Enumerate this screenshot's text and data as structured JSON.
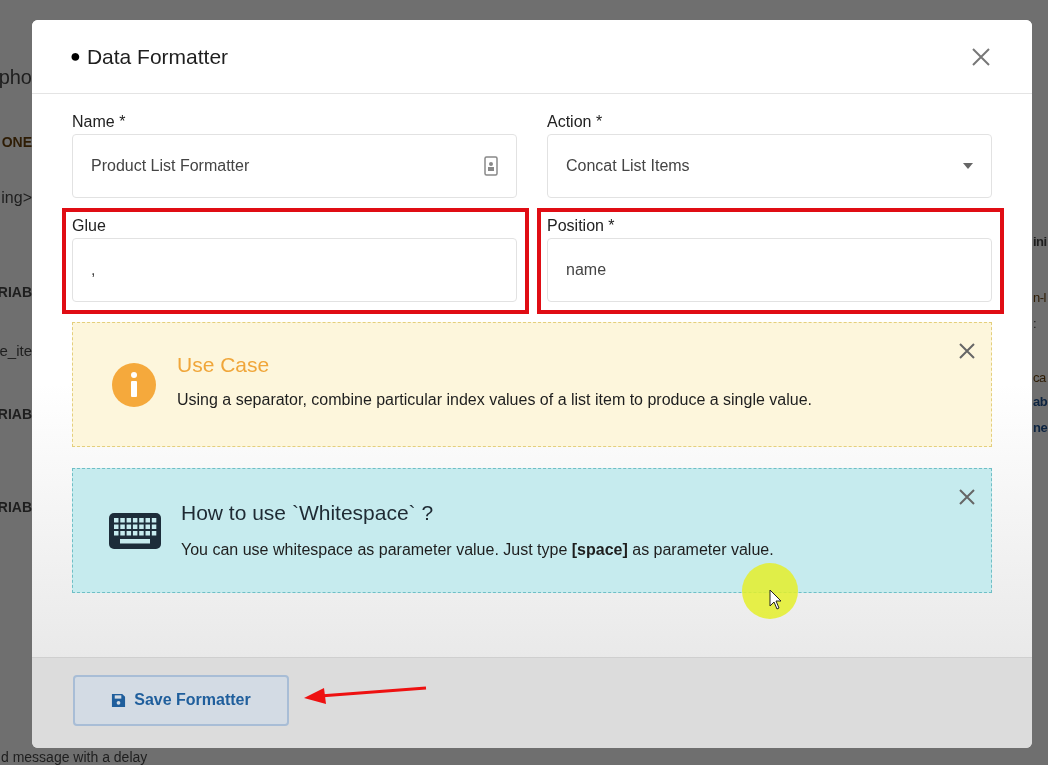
{
  "background": {
    "left_fragments": [
      "pho",
      "ONE",
      "ing>",
      "RIAB",
      "e_ite",
      "RIAB",
      "RIAB"
    ],
    "right_fragments": [
      "ini",
      "n-l",
      ":",
      "ca",
      "ab",
      "ne"
    ],
    "bottom_text": "d message with a delay"
  },
  "dialog": {
    "title_marker": "●",
    "title": "Data Formatter",
    "fields": [
      {
        "kind": "text",
        "label": "Name *",
        "value": "Product List Formatter",
        "highlighted": false
      },
      {
        "kind": "select",
        "label": "Action *",
        "value": "Concat List Items",
        "highlighted": false
      },
      {
        "kind": "text",
        "label": "Glue",
        "value": ",",
        "highlighted": true
      },
      {
        "kind": "text",
        "label": "Position *",
        "value": "name",
        "highlighted": true
      }
    ],
    "alerts": [
      {
        "kind": "info",
        "title": "Use Case",
        "text": "Using a separator, combine particular index values of a list item to produce a single value."
      },
      {
        "kind": "keyboard",
        "title": "How to use `Whitespace` ?",
        "text": "You can use whitespace as parameter value. Just type **[space]** as parameter value."
      }
    ],
    "save_button": "Save Formatter"
  }
}
